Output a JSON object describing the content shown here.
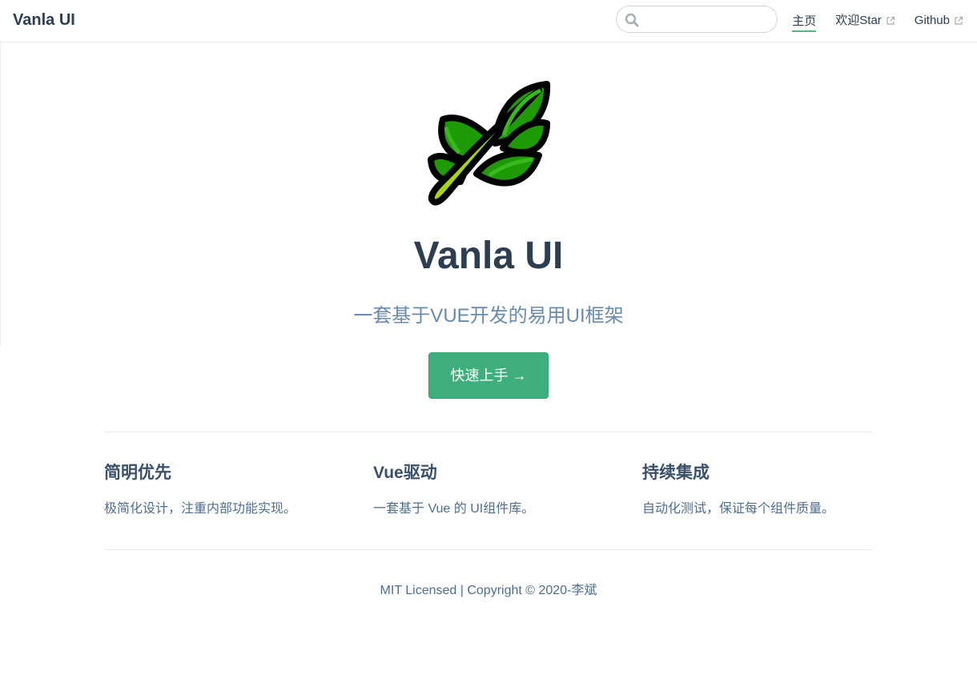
{
  "navbar": {
    "site_name": "Vanla UI",
    "search": {
      "placeholder": "",
      "value": "",
      "icon": "search-icon"
    },
    "links": [
      {
        "label": "主页",
        "active": true,
        "external": false
      },
      {
        "label": "欢迎Star",
        "active": false,
        "external": true,
        "icon": "external-link-icon"
      },
      {
        "label": "Github",
        "active": false,
        "external": true,
        "icon": "external-link-icon"
      }
    ]
  },
  "hero": {
    "logo": "leaf-branch-logo",
    "title": "Vanla UI",
    "description": "一套基于VUE开发的易用UI框架",
    "action_label": "快速上手 →"
  },
  "features": [
    {
      "title": "简明优先",
      "details": "极简化设计，注重内部功能实现。"
    },
    {
      "title": "Vue驱动",
      "details": "一套基于 Vue 的 UI组件库。"
    },
    {
      "title": "持续集成",
      "details": "自动化测试，保证每个组件质量。"
    }
  ],
  "footer": {
    "text": "MIT Licensed | Copyright © 2020-李斌"
  },
  "colors": {
    "accent": "#3eaf7c",
    "text": "#2c3e50",
    "muted": "#6a8bad",
    "leaf_dark": "#1f9a07",
    "leaf_stem": "#a8d416",
    "outline": "#000000"
  }
}
